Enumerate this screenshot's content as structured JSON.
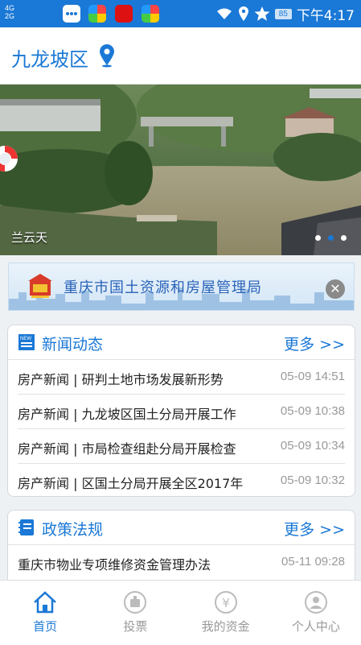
{
  "status": {
    "signal_line1": "4G",
    "signal_line2": "2G",
    "battery": "85",
    "time": "下午4:17"
  },
  "header": {
    "city": "九龙坡区",
    "location_icon": "location-pin-icon"
  },
  "banner": {
    "caption": "兰云天",
    "active_slide": 2,
    "slide_count": 3
  },
  "ad": {
    "title": "重庆市国土资源和房屋管理局"
  },
  "news": {
    "title": "新闻动态",
    "more": "更多 >>",
    "items": [
      {
        "title": "房产新闻 | 研判土地市场发展新形势",
        "date": "05-09 14:51"
      },
      {
        "title": "房产新闻 | 九龙坡区国土分局开展工作",
        "date": "05-09 10:38"
      },
      {
        "title": "房产新闻 | 市局检查组赴分局开展检查",
        "date": "05-09 10:34"
      },
      {
        "title": "房产新闻 | 区国土分局开展全区2017年",
        "date": "05-09 10:32"
      }
    ]
  },
  "policy": {
    "title": "政策法规",
    "more": "更多 >>",
    "items": [
      {
        "title": "重庆市物业专项维修资金管理办法",
        "date": "05-11 09:28"
      }
    ]
  },
  "tabs": [
    {
      "label": "首页",
      "icon": "home-icon",
      "active": true
    },
    {
      "label": "投票",
      "icon": "vote-icon",
      "active": false
    },
    {
      "label": "我的资金",
      "icon": "yuan-icon",
      "active": false
    },
    {
      "label": "个人中心",
      "icon": "person-icon",
      "active": false
    }
  ],
  "colors": {
    "primary": "#1a78d6",
    "inactive": "#999999"
  }
}
